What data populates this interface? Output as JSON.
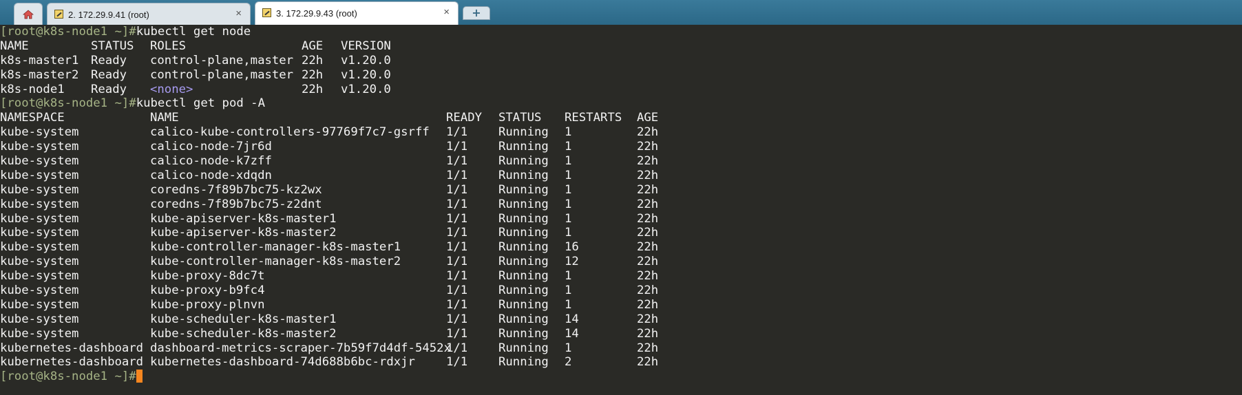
{
  "tabs": [
    {
      "label": "",
      "icon": "home-icon"
    },
    {
      "label": "2. 172.29.9.41 (root)",
      "icon": "pencil-icon",
      "close": "×"
    },
    {
      "label": "3. 172.29.9.43 (root)",
      "icon": "pencil-icon",
      "close": "×"
    }
  ],
  "new_tab_label": "+",
  "prompts": {
    "p1": {
      "open": "[",
      "user": "root@k8s-node1",
      "dir": " ~",
      "close": "]#",
      "cmd": "kubectl get node"
    },
    "p2": {
      "open": "[",
      "user": "root@k8s-node1",
      "dir": " ~",
      "close": "]#",
      "cmd": "kubectl get pod -A"
    },
    "p3": {
      "open": "[",
      "user": "root@k8s-node1",
      "dir": " ~",
      "close": "]#",
      "cmd": ""
    }
  },
  "nodes": {
    "headers": [
      "NAME",
      "STATUS",
      "ROLES",
      "AGE",
      "VERSION"
    ],
    "rows": [
      [
        "k8s-master1",
        "Ready",
        "control-plane,master",
        "22h",
        "v1.20.0"
      ],
      [
        "k8s-master2",
        "Ready",
        "control-plane,master",
        "22h",
        "v1.20.0"
      ],
      [
        "k8s-node1",
        "Ready",
        "<none>",
        "22h",
        "v1.20.0"
      ]
    ]
  },
  "pods": {
    "headers": [
      "NAMESPACE",
      "NAME",
      "READY",
      "STATUS",
      "RESTARTS",
      "AGE"
    ],
    "rows": [
      [
        "kube-system",
        "calico-kube-controllers-97769f7c7-gsrff",
        "1/1",
        "Running",
        "1",
        "22h"
      ],
      [
        "kube-system",
        "calico-node-7jr6d",
        "1/1",
        "Running",
        "1",
        "22h"
      ],
      [
        "kube-system",
        "calico-node-k7zff",
        "1/1",
        "Running",
        "1",
        "22h"
      ],
      [
        "kube-system",
        "calico-node-xdqdn",
        "1/1",
        "Running",
        "1",
        "22h"
      ],
      [
        "kube-system",
        "coredns-7f89b7bc75-kz2wx",
        "1/1",
        "Running",
        "1",
        "22h"
      ],
      [
        "kube-system",
        "coredns-7f89b7bc75-z2dnt",
        "1/1",
        "Running",
        "1",
        "22h"
      ],
      [
        "kube-system",
        "kube-apiserver-k8s-master1",
        "1/1",
        "Running",
        "1",
        "22h"
      ],
      [
        "kube-system",
        "kube-apiserver-k8s-master2",
        "1/1",
        "Running",
        "1",
        "22h"
      ],
      [
        "kube-system",
        "kube-controller-manager-k8s-master1",
        "1/1",
        "Running",
        "16",
        "22h"
      ],
      [
        "kube-system",
        "kube-controller-manager-k8s-master2",
        "1/1",
        "Running",
        "12",
        "22h"
      ],
      [
        "kube-system",
        "kube-proxy-8dc7t",
        "1/1",
        "Running",
        "1",
        "22h"
      ],
      [
        "kube-system",
        "kube-proxy-b9fc4",
        "1/1",
        "Running",
        "1",
        "22h"
      ],
      [
        "kube-system",
        "kube-proxy-plnvn",
        "1/1",
        "Running",
        "1",
        "22h"
      ],
      [
        "kube-system",
        "kube-scheduler-k8s-master1",
        "1/1",
        "Running",
        "14",
        "22h"
      ],
      [
        "kube-system",
        "kube-scheduler-k8s-master2",
        "1/1",
        "Running",
        "14",
        "22h"
      ],
      [
        "kubernetes-dashboard",
        "dashboard-metrics-scraper-7b59f7d4df-5452x",
        "1/1",
        "Running",
        "1",
        "22h"
      ],
      [
        "kubernetes-dashboard",
        "kubernetes-dashboard-74d688b6bc-rdxjr",
        "1/1",
        "Running",
        "2",
        "22h"
      ]
    ]
  },
  "colors": {
    "background": "#2a2a26",
    "text": "#f2f2f2",
    "prompt": "#a6b486",
    "none_value": "#a79bf0",
    "cursor": "#f5861f",
    "tabbar": "#2b6887"
  }
}
